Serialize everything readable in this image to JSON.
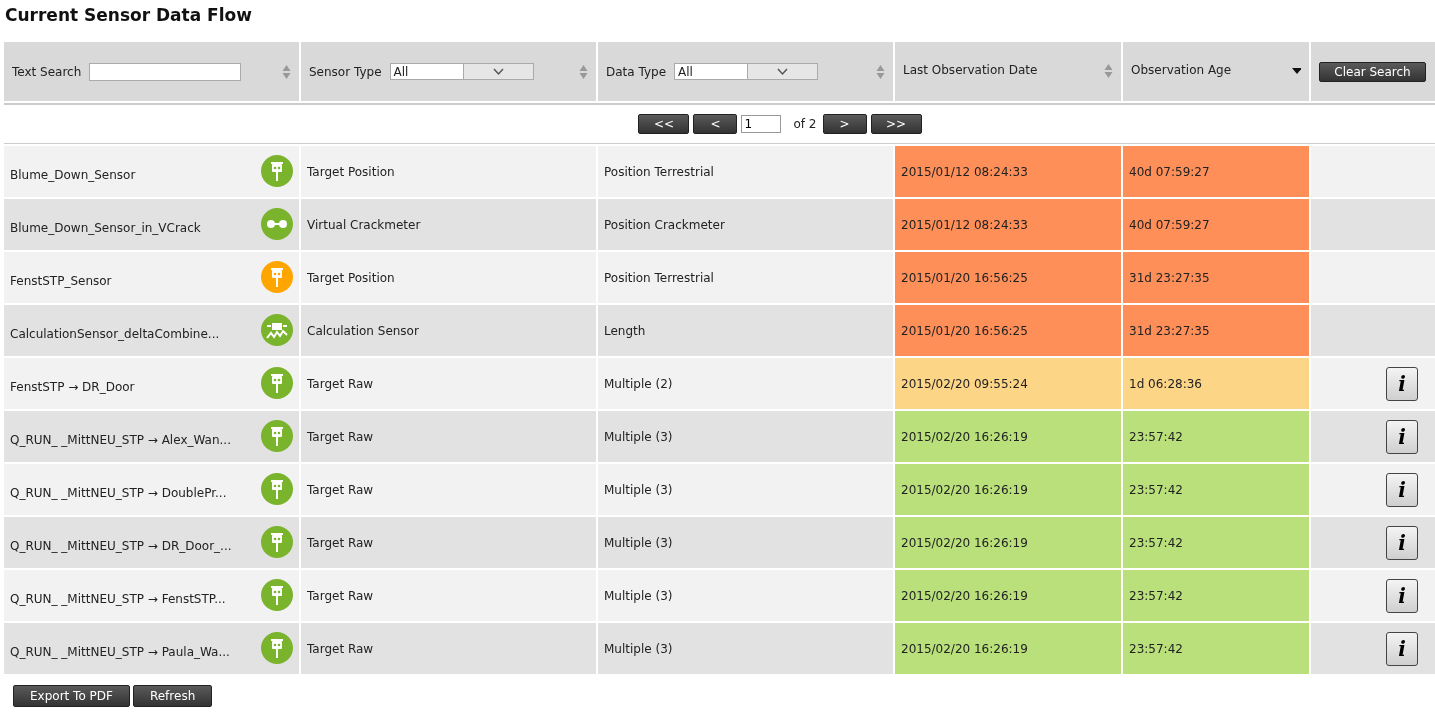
{
  "title": "Current Sensor Data Flow",
  "filters": {
    "text_search": {
      "label": "Text Search"
    },
    "sensor_type": {
      "label": "Sensor Type",
      "value": "All"
    },
    "data_type": {
      "label": "Data Type",
      "value": "All"
    },
    "last_observation": {
      "label": "Last Observation Date"
    },
    "observation_age": {
      "label": "Observation Age"
    },
    "clear_button": "Clear Search"
  },
  "pager": {
    "first": "<<",
    "prev": "<",
    "page": "1",
    "of": "of 2",
    "next": ">",
    "last": ">>"
  },
  "rows": [
    {
      "name": "Blume_Down_Sensor",
      "icon": {
        "kind": "target",
        "color": "#7ab32c"
      },
      "sensor_type": "Target Position",
      "data_type": "Position Terrestrial",
      "date": "2015/01/12 08:24:33",
      "age": "40d 07:59:27",
      "color": "#ff8f59"
    },
    {
      "name": "Blume_Down_Sensor_in_VCrack",
      "icon": {
        "kind": "crackmeter",
        "color": "#7ab32c"
      },
      "sensor_type": "Virtual Crackmeter",
      "data_type": "Position Crackmeter",
      "date": "2015/01/12 08:24:33",
      "age": "40d 07:59:27",
      "color": "#ff8f59"
    },
    {
      "name": "FenstSTP_Sensor",
      "icon": {
        "kind": "target",
        "color": "#ffa500"
      },
      "sensor_type": "Target Position",
      "data_type": "Position Terrestrial",
      "date": "2015/01/20 16:56:25",
      "age": "31d 23:27:35",
      "color": "#ff8f59"
    },
    {
      "name": "CalculationSensor_deltaCombine...",
      "icon": {
        "kind": "calculation",
        "color": "#7ab32c"
      },
      "sensor_type": "Calculation Sensor",
      "data_type": "Length",
      "date": "2015/01/20 16:56:25",
      "age": "31d 23:27:35",
      "color": "#ff8f59"
    },
    {
      "name": "FenstSTP → DR_Door",
      "icon": {
        "kind": "target",
        "color": "#7ab32c"
      },
      "sensor_type": "Target Raw",
      "data_type": "Multiple (2)",
      "date": "2015/02/20 09:55:24",
      "age": "1d 06:28:36",
      "color": "#fdd587",
      "info_button": "i"
    },
    {
      "name": "Q_RUN_ _MittNEU_STP → Alex_Wan...",
      "icon": {
        "kind": "target",
        "color": "#7ab32c"
      },
      "sensor_type": "Target Raw",
      "data_type": "Multiple (3)",
      "date": "2015/02/20 16:26:19",
      "age": "23:57:42",
      "color": "#b9e07b",
      "info_button": "i"
    },
    {
      "name": "Q_RUN_ _MittNEU_STP → DoublePr...",
      "icon": {
        "kind": "target",
        "color": "#7ab32c"
      },
      "sensor_type": "Target Raw",
      "data_type": "Multiple (3)",
      "date": "2015/02/20 16:26:19",
      "age": "23:57:42",
      "color": "#b9e07b",
      "info_button": "i"
    },
    {
      "name": "Q_RUN_ _MittNEU_STP → DR_Door_...",
      "icon": {
        "kind": "target",
        "color": "#7ab32c"
      },
      "sensor_type": "Target Raw",
      "data_type": "Multiple (3)",
      "date": "2015/02/20 16:26:19",
      "age": "23:57:42",
      "color": "#b9e07b",
      "info_button": "i"
    },
    {
      "name": "Q_RUN_ _MittNEU_STP → FenstSTP...",
      "icon": {
        "kind": "target",
        "color": "#7ab32c"
      },
      "sensor_type": "Target Raw",
      "data_type": "Multiple (3)",
      "date": "2015/02/20 16:26:19",
      "age": "23:57:42",
      "color": "#b9e07b",
      "info_button": "i"
    },
    {
      "name": "Q_RUN_ _MittNEU_STP → Paula_Wa...",
      "icon": {
        "kind": "target",
        "color": "#7ab32c"
      },
      "sensor_type": "Target Raw",
      "data_type": "Multiple (3)",
      "date": "2015/02/20 16:26:19",
      "age": "23:57:42",
      "color": "#b9e07b",
      "info_button": "i"
    }
  ],
  "footer_buttons": [
    "Export To PDF",
    "Refresh"
  ]
}
